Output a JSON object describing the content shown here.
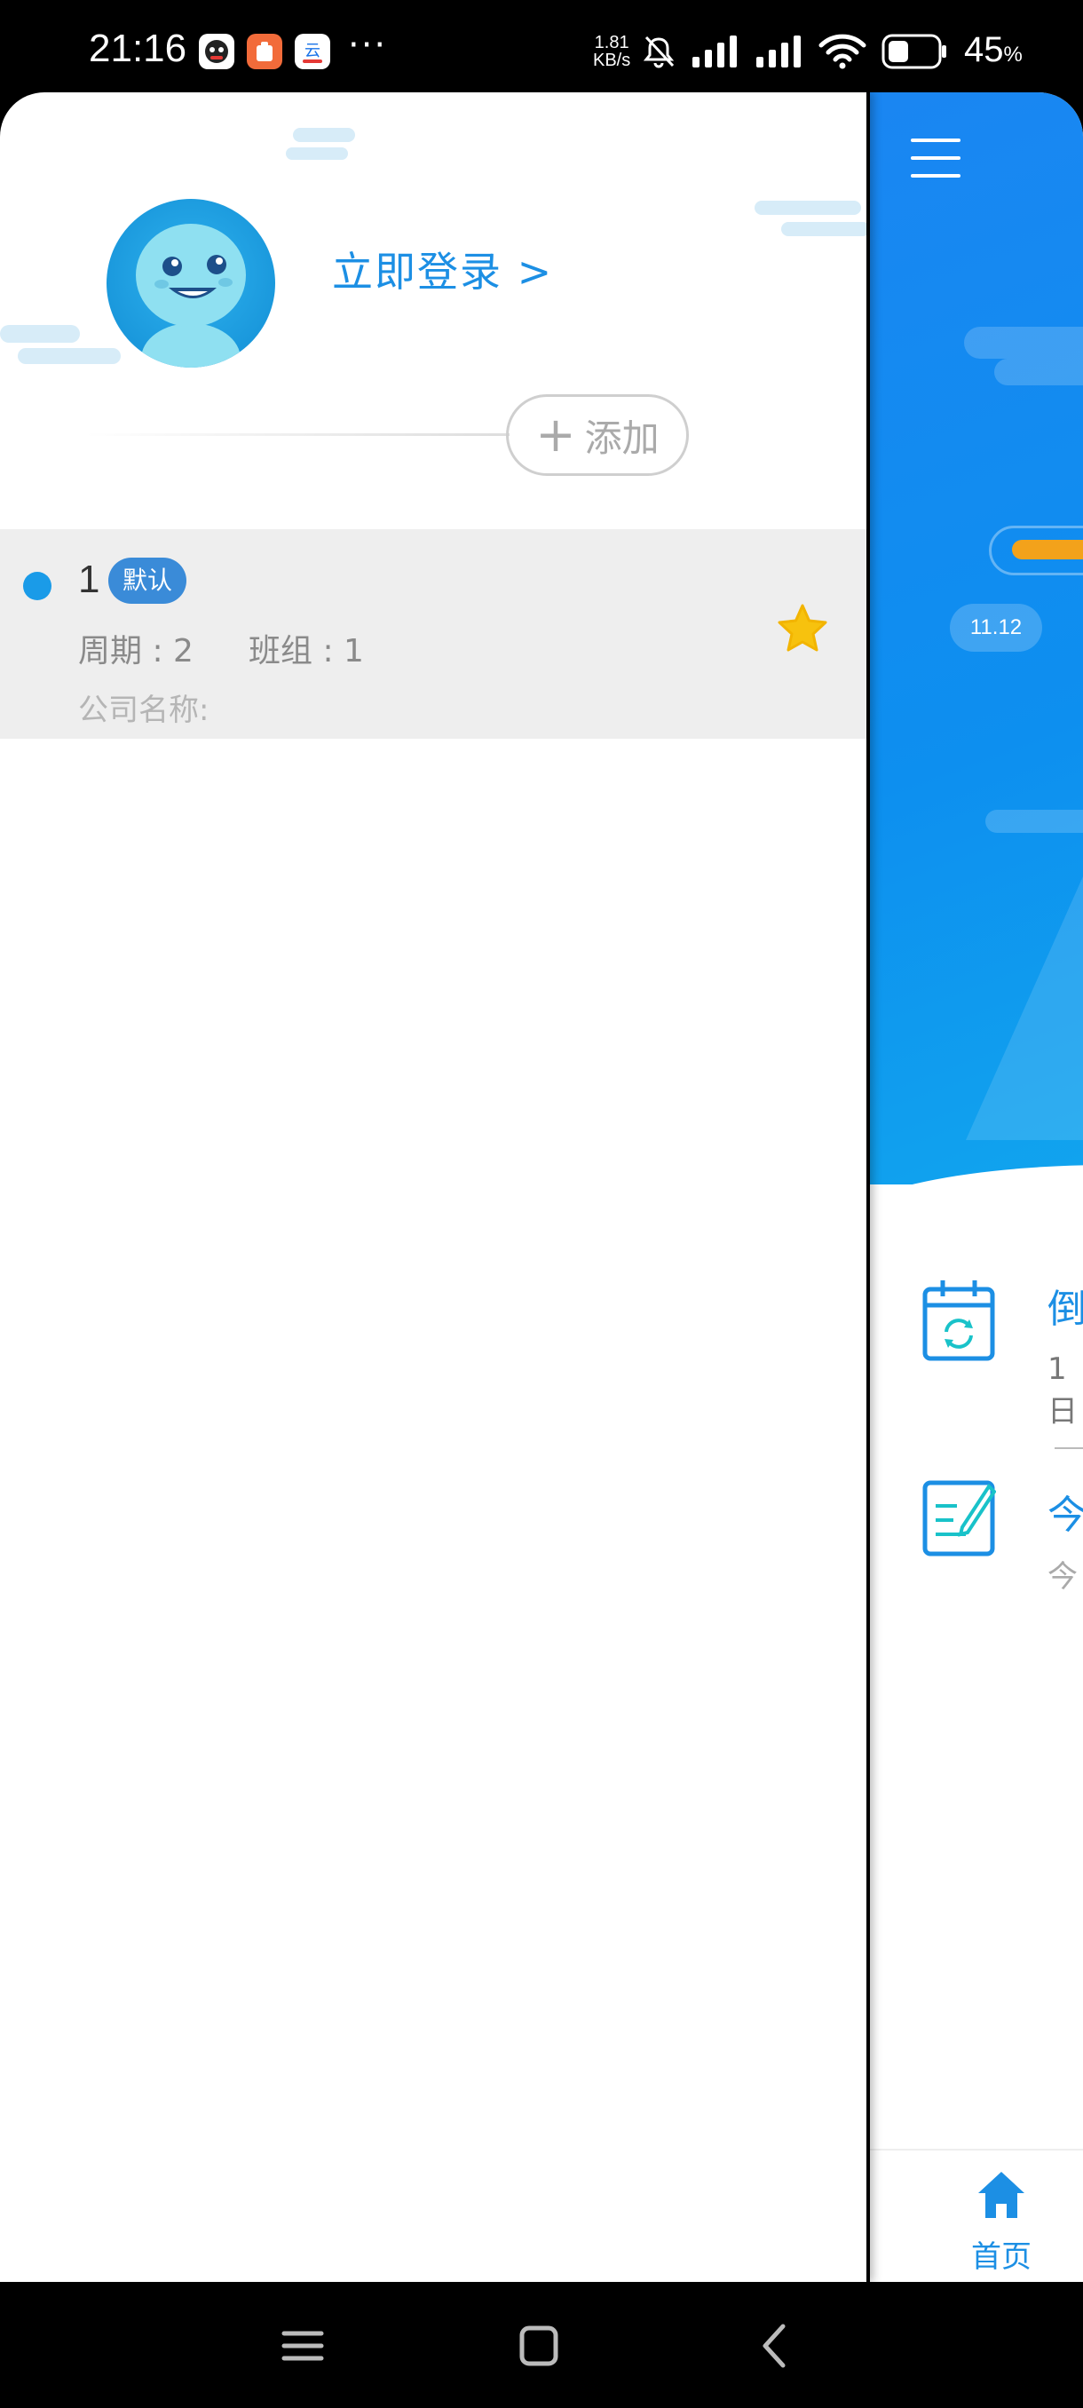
{
  "status_bar": {
    "time": "21:16",
    "more": "···",
    "net_speed_value": "1.81",
    "net_speed_unit": "KB/s",
    "battery": "45",
    "battery_unit": "%"
  },
  "drawer": {
    "login_link": "立即登录  >",
    "add_button": "添加",
    "items": [
      {
        "name": "1",
        "badge": "默认",
        "period": "周期 : 2",
        "team": "班组 : 1",
        "company": "公司名称:",
        "starred": true
      }
    ]
  },
  "main": {
    "date_pill": "11.12",
    "card1_title": "倒",
    "card1_sub": "1 日",
    "card2_title": "今",
    "card2_sub": "今",
    "bottom_nav_home": "首页"
  },
  "colors": {
    "accent": "#1c8fe4",
    "badge": "#3a8bd8",
    "star": "#f7c20e",
    "hero": "#1a86f2",
    "progress": "#f3a21b"
  }
}
